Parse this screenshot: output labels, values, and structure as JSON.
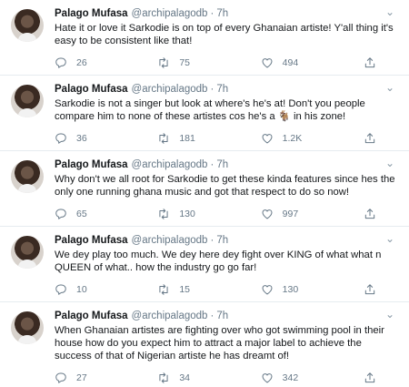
{
  "tweets": [
    {
      "name": "Palago Mufasa",
      "handle": "@archipalagodb",
      "dot": "·",
      "time": "7h",
      "text": "Hate it or love it Sarkodie is on top of every Ghanaian artiste! Y'all thing it's easy to be consistent like that!",
      "replies": "26",
      "retweets": "75",
      "likes": "494"
    },
    {
      "name": "Palago Mufasa",
      "handle": "@archipalagodb",
      "dot": "·",
      "time": "7h",
      "text": "Sarkodie is not a singer but look at where's he's at! Don't you people compare him to none of these artistes cos he's a 🐐 in his zone!",
      "replies": "36",
      "retweets": "181",
      "likes": "1.2K"
    },
    {
      "name": "Palago Mufasa",
      "handle": "@archipalagodb",
      "dot": "·",
      "time": "7h",
      "text": "Why don't we all root for Sarkodie to get these kinda features since hes the only one running ghana music and got that respect to do so now!",
      "replies": "65",
      "retweets": "130",
      "likes": "997"
    },
    {
      "name": "Palago Mufasa",
      "handle": "@archipalagodb",
      "dot": "·",
      "time": "7h",
      "text": "We dey play too much. We dey here dey fight over KING of what what n QUEEN of what.. how the industry go go far!",
      "replies": "10",
      "retweets": "15",
      "likes": "130"
    },
    {
      "name": "Palago Mufasa",
      "handle": "@archipalagodb",
      "dot": "·",
      "time": "7h",
      "text": "When Ghanaian artistes are fighting over who got swimming pool in their house how do you expect him to attract a major label to achieve the success of that of Nigerian artiste he has dreamt of!",
      "replies": "27",
      "retweets": "34",
      "likes": "342"
    }
  ],
  "icons": {
    "reply": "reply-icon",
    "retweet": "retweet-icon",
    "like": "heart-icon",
    "share": "share-icon",
    "more": "chevron-down-icon"
  },
  "colors": {
    "text": "#14171a",
    "muted": "#657786",
    "divider": "#e6ecf0"
  }
}
